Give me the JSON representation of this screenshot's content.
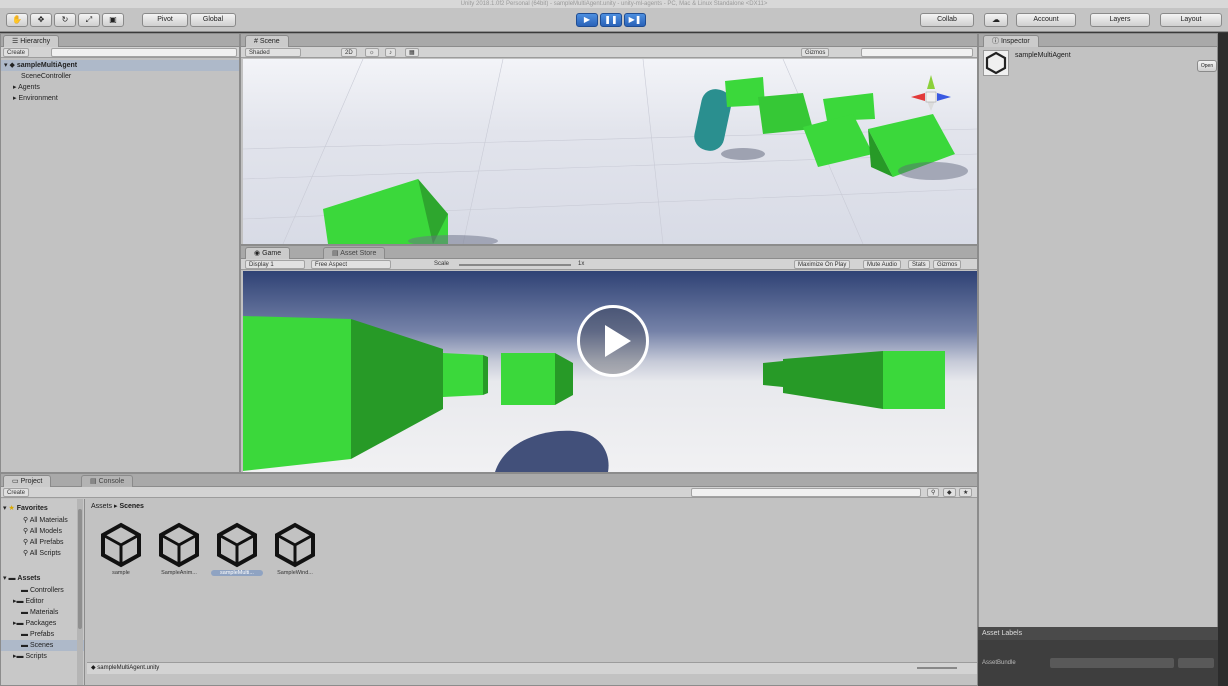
{
  "window": {
    "title": "Unity 2018.1.0f2 Personal (64bit) - sampleMultiAgent.unity - unity-ml-agents - PC, Mac & Linux Standalone <DX11>"
  },
  "toolbar": {
    "pivot_label": "Pivot",
    "global_label": "Global",
    "collab_label": "Collab",
    "account_label": "Account",
    "layers_label": "Layers",
    "layout_label": "Layout"
  },
  "hierarchy": {
    "tab": "Hierarchy",
    "create_label": "Create",
    "items": [
      {
        "label": "sampleMultiAgent"
      },
      {
        "label": "SceneController"
      },
      {
        "label": "Agents"
      },
      {
        "label": "Environment"
      }
    ]
  },
  "scene": {
    "tab": "Scene",
    "shading_mode": "Shaded",
    "mode_2d": "2D",
    "gizmos_label": "Gizmos"
  },
  "game": {
    "tab": "Game",
    "tab2": "Asset Store",
    "display": "Display 1",
    "aspect": "Free Aspect",
    "scale_label": "Scale",
    "scale_value": "1x",
    "maximize": "Maximize On Play",
    "mute": "Mute Audio",
    "stats": "Stats",
    "gizmos": "Gizmos"
  },
  "inspector": {
    "tab": "Inspector",
    "object_name": "sampleMultiAgent",
    "open_label": "Open",
    "asset_labels": "Asset Labels",
    "asset_bundle": "AssetBundle"
  },
  "project": {
    "tab": "Project",
    "tab2": "Console",
    "create_label": "Create",
    "favorites": "Favorites",
    "favorites_items": [
      {
        "label": "All Materials"
      },
      {
        "label": "All Models"
      },
      {
        "label": "All Prefabs"
      },
      {
        "label": "All Scripts"
      }
    ],
    "assets_root": "Assets",
    "assets_items": [
      {
        "label": "Controllers"
      },
      {
        "label": "Editor"
      },
      {
        "label": "Materials"
      },
      {
        "label": "Packages"
      },
      {
        "label": "Prefabs"
      },
      {
        "label": "Scenes"
      },
      {
        "label": "Scripts"
      }
    ],
    "breadcrumb_root": "Assets",
    "breadcrumb_current": "Scenes",
    "files": [
      {
        "label": "sample"
      },
      {
        "label": "SampleAnim..."
      },
      {
        "label": "sampleMulti..."
      },
      {
        "label": "SampleWind..."
      }
    ],
    "footer_path": "sampleMultiAgent.unity"
  },
  "colors": {
    "accent": "#2a62b8",
    "green_cube": "#3bd83b",
    "green_cube_dark": "#269426"
  }
}
